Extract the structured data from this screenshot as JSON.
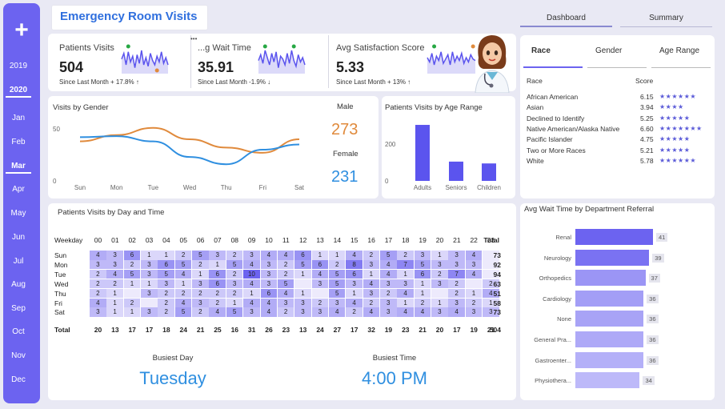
{
  "sidebar": {
    "add_label": "+",
    "items": [
      "2019",
      "2020",
      "Jan",
      "Feb",
      "Mar",
      "Apr",
      "May",
      "Jun",
      "Jul",
      "Aug",
      "Sep",
      "Oct",
      "Nov",
      "Dec"
    ],
    "active": [
      "2020",
      "Mar"
    ]
  },
  "header": {
    "title": "Emergency Room Visits"
  },
  "tabs": {
    "dashboard": "Dashboard",
    "summary": "Summary"
  },
  "kpis": [
    {
      "label": "Patients Visits",
      "value": "504",
      "sub": "Since Last Month + 17.8% ↑"
    },
    {
      "label": "...g Wait Time",
      "value": "35.91",
      "sub": "Since Last Month -1.9% ↓"
    },
    {
      "label": "Avg Satisfaction Score",
      "value": "5.33",
      "sub": "Since Last Month + 13% ↑"
    }
  ],
  "more_icon": "•••",
  "gender_chart": {
    "title": "Visits by Gender",
    "male_label": "Male",
    "male_value": "273",
    "female_label": "Female",
    "female_value": "231"
  },
  "age_chart": {
    "title": "Patients Visits by Age Range"
  },
  "race_panel": {
    "tabs": [
      "Race",
      "Gender",
      "Age Range"
    ],
    "col_race": "Race",
    "col_score": "Score",
    "rows": [
      {
        "name": "African American",
        "score": "6.15",
        "stars": "★★★★★★"
      },
      {
        "name": "Asian",
        "score": "3.94",
        "stars": "★★★★"
      },
      {
        "name": "Declined to Identify",
        "score": "5.25",
        "stars": "★★★★★"
      },
      {
        "name": "Native American/Alaska Native",
        "score": "6.60",
        "stars": "★★★★★★★"
      },
      {
        "name": "Pacific Islander",
        "score": "4.75",
        "stars": "★★★★★"
      },
      {
        "name": "Two or More Races",
        "score": "5.21",
        "stars": "★★★★★"
      },
      {
        "name": "White",
        "score": "5.78",
        "stars": "★★★★★★"
      }
    ]
  },
  "heatmap": {
    "title": "Patients Visits by Day and Time",
    "corner": "Weekday",
    "hours": [
      "00",
      "01",
      "02",
      "03",
      "04",
      "05",
      "06",
      "07",
      "08",
      "09",
      "10",
      "11",
      "12",
      "13",
      "14",
      "15",
      "16",
      "17",
      "18",
      "19",
      "20",
      "21",
      "22",
      "23"
    ],
    "total_label": "Total",
    "days": [
      "Sun",
      "Mon",
      "Tue",
      "Wed",
      "Thu",
      "Fri",
      "Sat"
    ],
    "cells": [
      [
        "4",
        "3",
        "6",
        "1",
        "1",
        "2",
        "5",
        "3",
        "2",
        "3",
        "4",
        "4",
        "6",
        "1",
        "1",
        "4",
        "2",
        "5",
        "2",
        "3",
        "1",
        "3",
        "4",
        ""
      ],
      [
        "3",
        "3",
        "2",
        "3",
        "6",
        "5",
        "2",
        "1",
        "5",
        "4",
        "3",
        "2",
        "5",
        "6",
        "2",
        "8",
        "3",
        "4",
        "7",
        "5",
        "3",
        "3",
        "3",
        ""
      ],
      [
        "2",
        "4",
        "5",
        "3",
        "5",
        "4",
        "1",
        "6",
        "2",
        "10",
        "3",
        "2",
        "1",
        "4",
        "5",
        "6",
        "1",
        "4",
        "1",
        "6",
        "2",
        "7",
        "4",
        ""
      ],
      [
        "2",
        "2",
        "1",
        "1",
        "3",
        "1",
        "3",
        "6",
        "3",
        "4",
        "3",
        "5",
        "",
        "3",
        "5",
        "3",
        "4",
        "3",
        "3",
        "1",
        "3",
        "2",
        "",
        "2"
      ],
      [
        "2",
        "1",
        "",
        "3",
        "2",
        "2",
        "2",
        "2",
        "2",
        "1",
        "6",
        "4",
        "1",
        "",
        "5",
        "1",
        "3",
        "2",
        "4",
        "1",
        "",
        "2",
        "1",
        "4"
      ],
      [
        "4",
        "1",
        "2",
        "",
        "2",
        "4",
        "3",
        "2",
        "1",
        "4",
        "4",
        "3",
        "3",
        "2",
        "3",
        "4",
        "2",
        "3",
        "1",
        "2",
        "1",
        "3",
        "2",
        "1"
      ],
      [
        "3",
        "1",
        "1",
        "3",
        "2",
        "5",
        "2",
        "4",
        "5",
        "3",
        "4",
        "2",
        "3",
        "3",
        "4",
        "2",
        "4",
        "3",
        "4",
        "4",
        "3",
        "4",
        "3",
        "3"
      ]
    ],
    "row_totals": [
      "73",
      "92",
      "94",
      "63",
      "51",
      "58",
      "73"
    ],
    "col_totals": [
      "20",
      "13",
      "17",
      "17",
      "18",
      "24",
      "21",
      "25",
      "16",
      "31",
      "26",
      "23",
      "13",
      "24",
      "27",
      "17",
      "32",
      "19",
      "23",
      "21",
      "20",
      "17",
      "19",
      "21"
    ],
    "grand_total": "504"
  },
  "busiest": {
    "day_label": "Busiest Day",
    "day_value": "Tuesday",
    "time_label": "Busiest Time",
    "time_value": "4:00 PM"
  },
  "dept_chart": {
    "title": "Avg Wait Time by Department Referral",
    "items": [
      {
        "name": "Renal",
        "value": "41"
      },
      {
        "name": "Neurology",
        "value": "39"
      },
      {
        "name": "Orthopedics",
        "value": "37"
      },
      {
        "name": "Cardiology",
        "value": "36"
      },
      {
        "name": "None",
        "value": "36"
      },
      {
        "name": "General Pra...",
        "value": "36"
      },
      {
        "name": "Gastroenter...",
        "value": "36"
      },
      {
        "name": "Physiothera...",
        "value": "34"
      }
    ]
  },
  "chart_data": [
    {
      "type": "line",
      "x": [
        "Sun",
        "Mon",
        "Tue",
        "Wed",
        "Thu",
        "Fri",
        "Sat"
      ],
      "series": [
        {
          "name": "Male",
          "values": [
            38,
            44,
            51,
            40,
            32,
            27,
            40
          ]
        },
        {
          "name": "Female",
          "values": [
            42,
            43,
            38,
            23,
            16,
            30,
            35
          ]
        }
      ],
      "yticks": [
        "0",
        "50"
      ],
      "ylim": [
        0,
        60
      ],
      "colors": {
        "Male": "#e08a3c",
        "Female": "#2f8fe0"
      }
    },
    {
      "type": "bar",
      "categories": [
        "Adults",
        "Seniors",
        "Children"
      ],
      "values": [
        305,
        105,
        95
      ],
      "yticks": [
        "0",
        "200"
      ],
      "ylim": [
        0,
        340
      ],
      "color": "#5b54ee"
    },
    {
      "type": "bar",
      "orientation": "horizontal",
      "categories": [
        "Renal",
        "Neurology",
        "Orthopedics",
        "Cardiology",
        "None",
        "General Pra...",
        "Gastroenter...",
        "Physiothera..."
      ],
      "values": [
        41,
        39,
        37,
        36,
        36,
        36,
        36,
        34
      ]
    }
  ]
}
